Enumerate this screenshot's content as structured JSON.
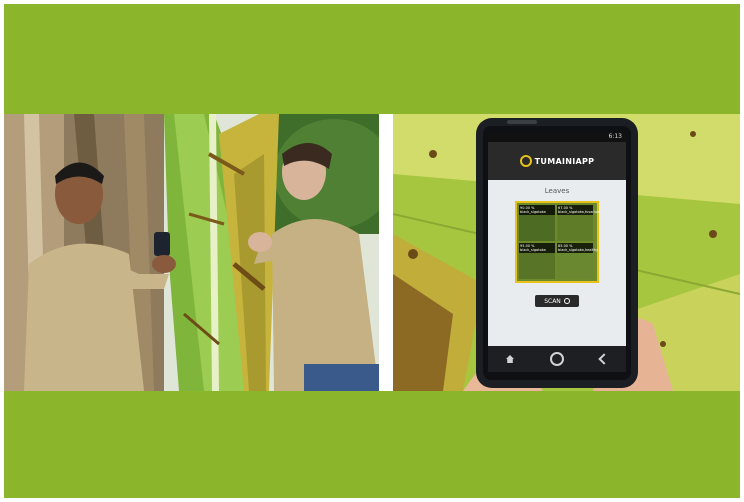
{
  "app": {
    "brand": "TUMAINIAPP",
    "status_time": "6:13",
    "section_label": "Leaves",
    "scan_button_label": "SCAN"
  },
  "results": [
    {
      "confidence": "90.00 %",
      "label": "black_sigatoka"
    },
    {
      "confidence": "67.00 %",
      "label": "black_sigatoka,fusarium"
    },
    {
      "confidence": "95.00 %",
      "label": "black_sigatoka"
    },
    {
      "confidence": "85.00 %",
      "label": "black_sigatoka,healthy"
    }
  ],
  "colors": {
    "frame_green": "#8bb52b",
    "app_header": "#2a2a2a",
    "result_border": "#e6c21a"
  },
  "icons": [
    "search-icon",
    "camera-icon",
    "home-icon",
    "back-icon"
  ]
}
